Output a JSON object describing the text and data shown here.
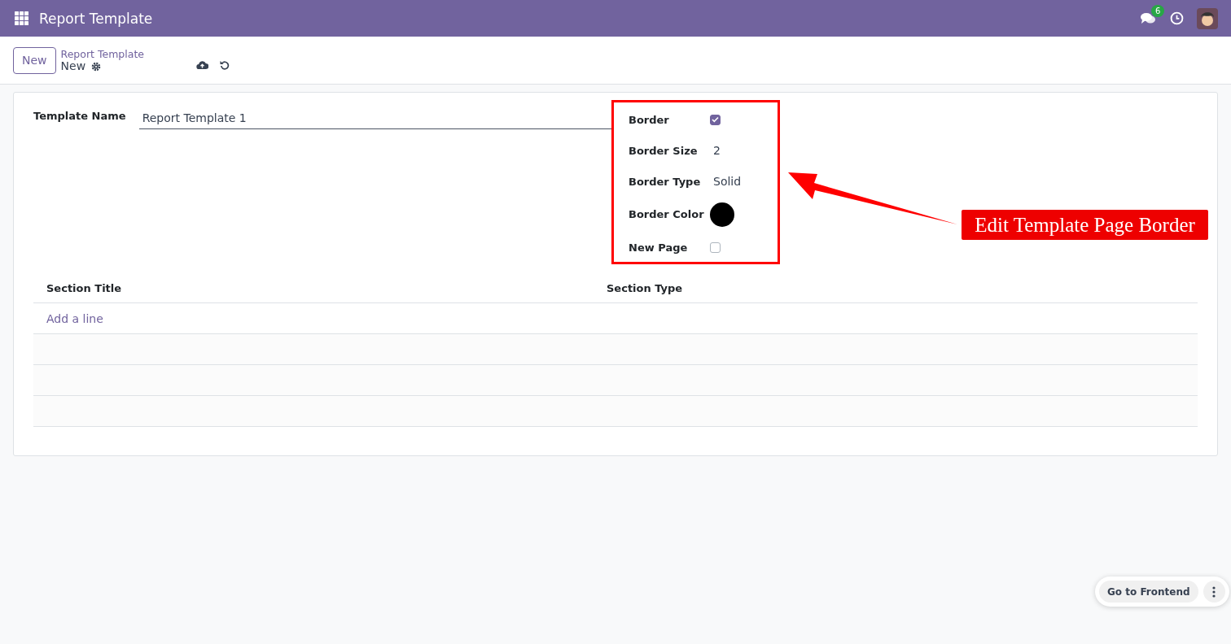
{
  "topbar": {
    "app_title": "Report Template",
    "notification_count": "6"
  },
  "control_panel": {
    "new_button": "New",
    "breadcrumb": "Report Template",
    "record_name": "New"
  },
  "form": {
    "template_name": {
      "label": "Template Name",
      "value": "Report Template 1"
    },
    "border_fields": [
      {
        "kind": "checkbox",
        "label": "Border",
        "checked": true
      },
      {
        "kind": "text",
        "label": "Border Size",
        "value": "2"
      },
      {
        "kind": "text",
        "label": "Border Type",
        "value": "Solid"
      },
      {
        "kind": "color",
        "label": "Border Color",
        "color": "#000000"
      },
      {
        "kind": "checkbox",
        "label": "New Page",
        "checked": false
      }
    ]
  },
  "sections_table": {
    "columns": [
      "Section Title",
      "Section Type"
    ],
    "add_line": "Add a line"
  },
  "annotation": {
    "callout": "Edit Template Page Border"
  },
  "floating_actions": {
    "button": "Go to Frontend"
  }
}
